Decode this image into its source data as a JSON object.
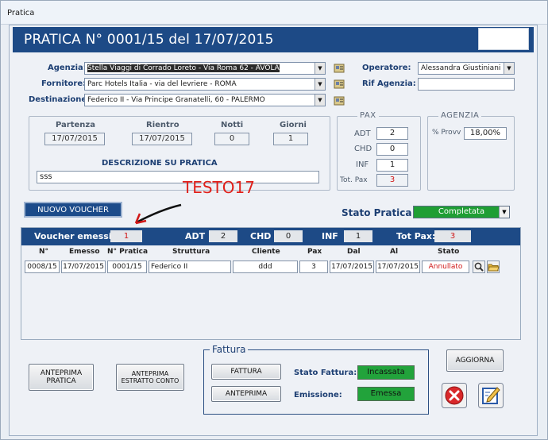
{
  "window": {
    "title": "Pratica"
  },
  "header": {
    "title": "PRATICA N°  0001/15   del  17/07/2015"
  },
  "form": {
    "agenzia_label": "Agenzia:",
    "agenzia_value": "Stella Viaggi di Corrado Loreto  -  Via Roma 62  -  AVOLA",
    "fornitore_label": "Fornitore:",
    "fornitore_value": "Parc Hotels Italia  -  via del levriere  -  ROMA",
    "destinazione_label": "Destinazione:",
    "destinazione_value": "Federico II  -  Via Principe Granatelli, 60  -  PALERMO",
    "operatore_label": "Operatore:",
    "operatore_value": "Alessandra Giustiniani",
    "rif_agenzia_label": "Rif Agenzia:",
    "rif_agenzia_value": ""
  },
  "dates": {
    "partenza_label": "Partenza",
    "partenza_value": "17/07/2015",
    "rientro_label": "Rientro",
    "rientro_value": "17/07/2015",
    "notti_label": "Notti",
    "notti_value": "0",
    "giorni_label": "Giorni",
    "giorni_value": "1",
    "descrizione_label": "DESCRIZIONE SU PRATICA",
    "descrizione_value": "sss"
  },
  "pax": {
    "title": "PAX",
    "adt_label": "ADT",
    "adt_value": "2",
    "chd_label": "CHD",
    "chd_value": "0",
    "inf_label": "INF",
    "inf_value": "1",
    "tot_label": "Tot. Pax",
    "tot_value": "3"
  },
  "agenzia_group": {
    "title": "AGENZIA",
    "provv_label": "% Provv",
    "provv_value": "18,00%"
  },
  "annotation": {
    "text": "TESTO17"
  },
  "buttons": {
    "nuovo_voucher": "NUOVO VOUCHER",
    "anteprima_pratica": "ANTEPRIMA\nPRATICA",
    "anteprima_estratto": "ANTEPRIMA\nESTRATTO CONTO",
    "fattura": "FATTURA",
    "anteprima": "ANTEPRIMA",
    "aggiorna": "AGGIORNA"
  },
  "stato": {
    "label": "Stato Pratica",
    "value": "Completata"
  },
  "voucher": {
    "emessi_label": "Voucher emessi:",
    "emessi_value": "1",
    "adt_label": "ADT",
    "adt_value": "2",
    "chd_label": "CHD",
    "chd_value": "0",
    "inf_label": "INF",
    "inf_value": "1",
    "tot_label": "Tot Pax:",
    "tot_value": "3",
    "columns": [
      "N°",
      "Emesso",
      "N° Pratica",
      "Struttura",
      "Cliente",
      "Pax",
      "Dal",
      "Al",
      "Stato"
    ],
    "rows": [
      {
        "n": "0008/15",
        "emesso": "17/07/2015",
        "pratica": "0001/15",
        "struttura": "Federico II",
        "cliente": "ddd",
        "pax": "3",
        "dal": "17/07/2015",
        "al": "17/07/2015",
        "stato": "Annullato"
      }
    ]
  },
  "fattura": {
    "title": "Fattura",
    "stato_label": "Stato Fattura:",
    "stato_value": "Incassata",
    "emissione_label": "Emissione:",
    "emissione_value": "Emessa"
  },
  "colors": {
    "header_blue": "#1d4a86",
    "status_green": "#22a33b",
    "alert_red": "#d01818"
  }
}
